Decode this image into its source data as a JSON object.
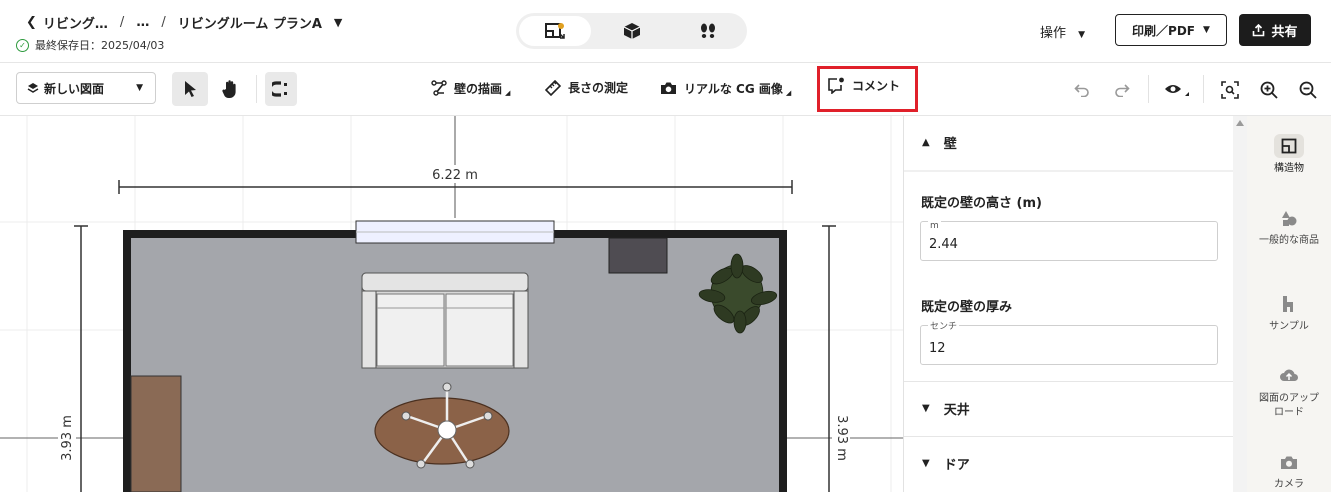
{
  "header": {
    "breadcrumb": {
      "project": "リビング…",
      "ellipsis": "…",
      "plan": "リビングルーム プランA"
    },
    "saved_text": "最終保存日：2025/04/03",
    "view_modes": [
      "2d-plan-icon",
      "3d-box-icon",
      "walkthrough-icon"
    ],
    "operations_label": "操作",
    "print_label": "印刷／PDF",
    "share_label": "共有"
  },
  "toolbar": {
    "new_plan_label": "新しい図面",
    "draw_wall_label": "壁の描画",
    "measure_label": "長さの測定",
    "cg_image_label": "リアルな CG 画像",
    "comment_label": "コメント",
    "highlight_color": "#e0202a"
  },
  "canvas": {
    "width_dim_label": "6.22 m",
    "left_height_label": "3.93 m",
    "right_height_label": "3.93 m",
    "floor_color": "#a4a6ab",
    "wall_color": "#1e1e1e"
  },
  "panel": {
    "wall_section_label": "壁",
    "wall_height_label": "既定の壁の高さ (m)",
    "wall_height_unit": "m",
    "wall_height_value": "2.44",
    "wall_thickness_label": "既定の壁の厚み",
    "wall_thickness_unit": "センチ",
    "wall_thickness_value": "12",
    "ceiling_label": "天井",
    "door_label": "ドア"
  },
  "rail": {
    "items": [
      {
        "label": "構造物",
        "icon": "structure-icon"
      },
      {
        "label": "一般的な商品",
        "icon": "products-icon"
      },
      {
        "label": "サンプル",
        "icon": "sample-icon"
      },
      {
        "label": "図面のアップロード",
        "icon": "upload-icon"
      },
      {
        "label": "カメラ",
        "icon": "camera-icon"
      }
    ]
  }
}
